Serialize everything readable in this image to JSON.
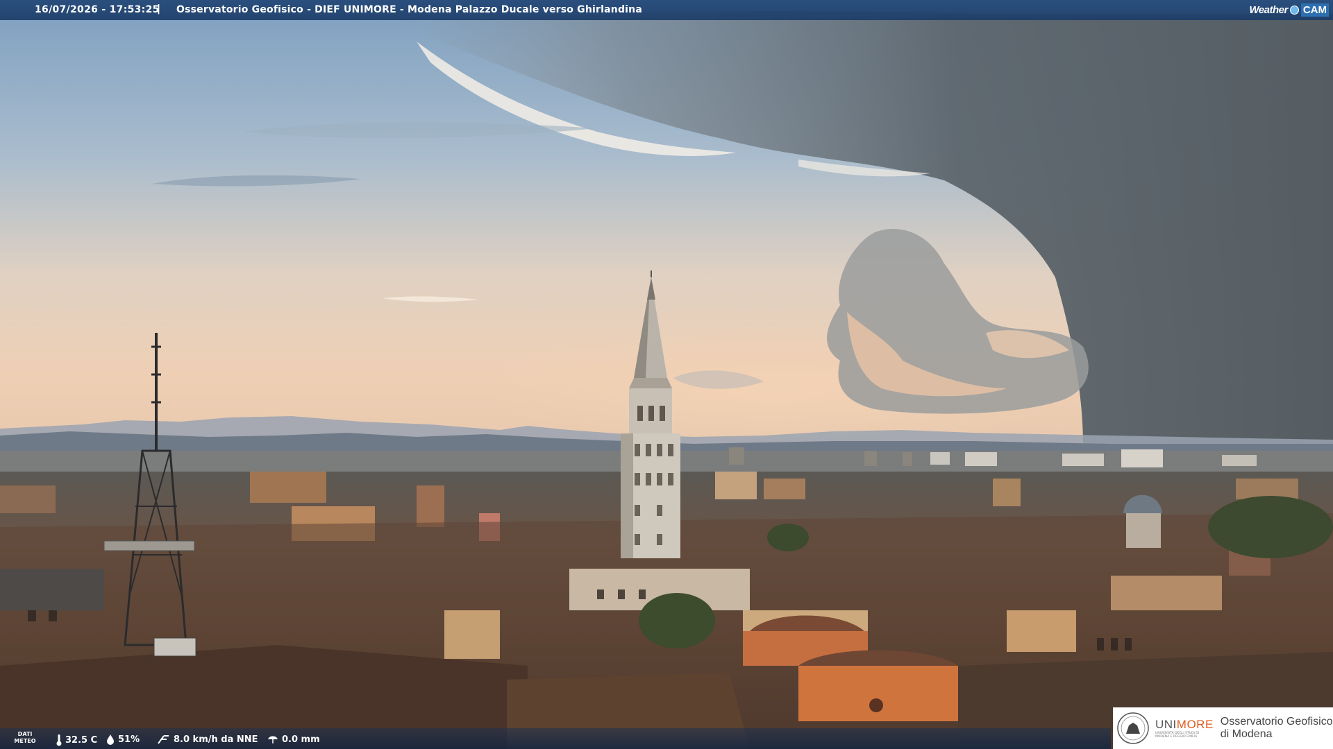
{
  "header": {
    "timestamp": "16/07/2026 - 17:53:25",
    "separator": "|",
    "title": "Osservatorio Geofisico - DIEF UNIMORE - Modena Palazzo Ducale verso Ghirlandina"
  },
  "brand": {
    "weather": "Weather",
    "cam": "CAM"
  },
  "weather_data": {
    "label_line1": "DATI",
    "label_line2": "METEO",
    "temperature": "32.5 C",
    "humidity": "51%",
    "wind": "8.0 km/h da NNE",
    "rain": "0.0 mm"
  },
  "logo": {
    "university_uni": "UNI",
    "university_more": "MORE",
    "university_sub1": "UNIVERSITÀ DEGLI STUDI DI",
    "university_sub2": "MODENA E REGGIO EMILIA",
    "observatory_line1": "Osservatorio Geofisico",
    "observatory_line2": "di Modena"
  },
  "icons": [
    "thermometer-icon",
    "humidity-drop-icon",
    "wind-icon",
    "rain-gauge-icon",
    "university-seal-icon"
  ]
}
